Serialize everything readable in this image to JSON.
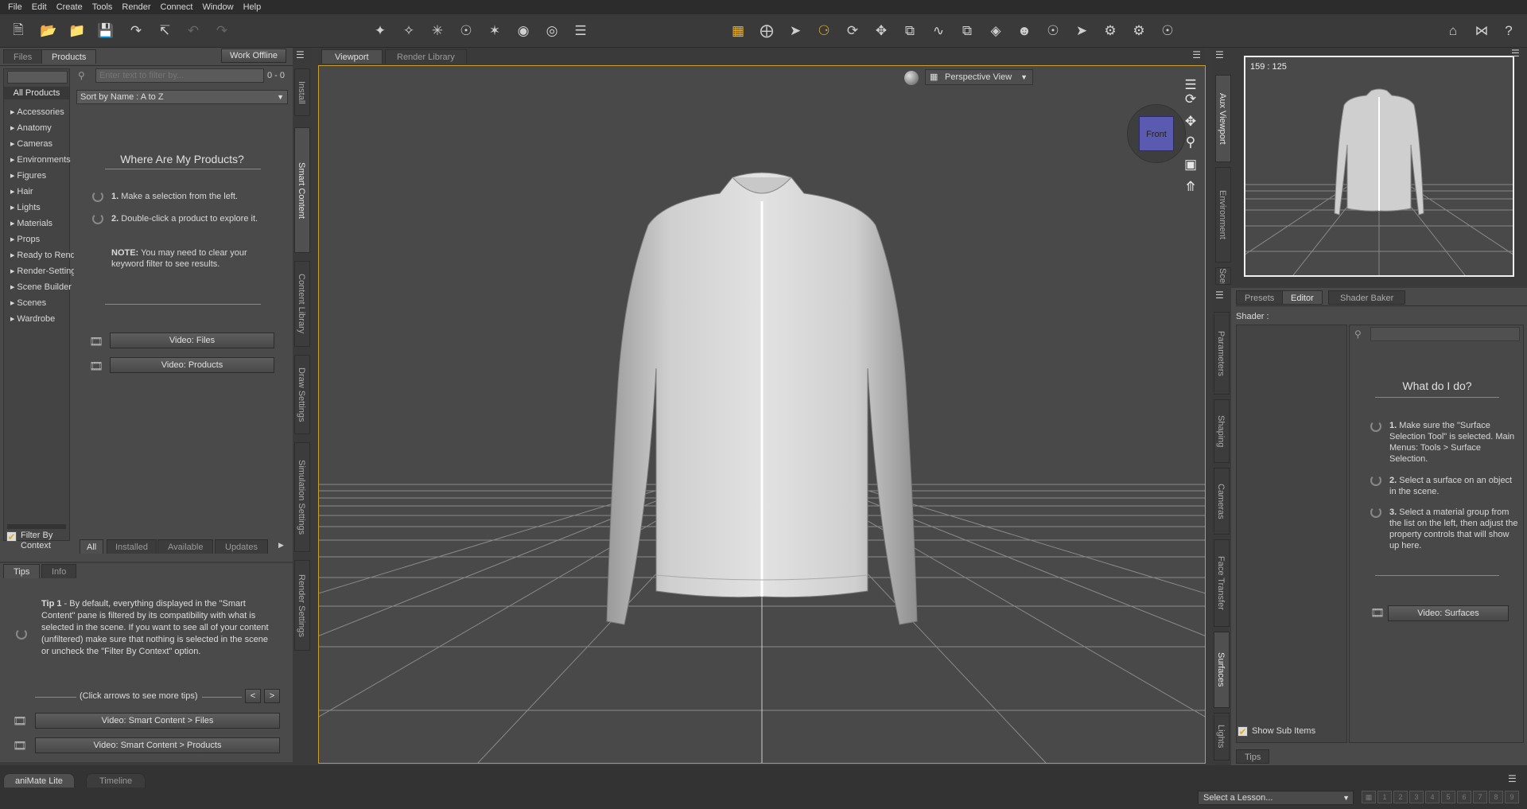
{
  "menu": [
    "File",
    "Edit",
    "Create",
    "Tools",
    "Render",
    "Connect",
    "Window",
    "Help"
  ],
  "left_panel": {
    "tabs": [
      "Files",
      "Products"
    ],
    "active_tab": "Products",
    "work_offline": "Work Offline",
    "filter_placeholder": "Enter text to filter by...",
    "count": "0 - 0",
    "sort": "Sort by Name : A to Z",
    "all_products": "All Products",
    "categories": [
      "Accessories",
      "Anatomy",
      "Cameras",
      "Environments",
      "Figures",
      "Hair",
      "Lights",
      "Materials",
      "Props",
      "Ready to Render",
      "Render-Settings",
      "Scene Builder",
      "Scenes",
      "Wardrobe"
    ],
    "help_title": "Where Are My Products?",
    "step1_num": "1.",
    "step1": "Make a selection from the left.",
    "step2_num": "2.",
    "step2": "Double-click a product to explore it.",
    "note_label": "NOTE:",
    "note": "You may need to clear your keyword filter to see results.",
    "video_files": "Video: Files",
    "video_products": "Video: Products",
    "filter_by_context": "Filter By Context",
    "bottom_tabs": [
      "All",
      "Installed",
      "Available",
      "Updates"
    ]
  },
  "side_vtabs": [
    "Install",
    "Smart Content",
    "Content Library",
    "Draw Settings",
    "Simulation Settings",
    "Render Settings"
  ],
  "tips_panel": {
    "tabs": [
      "Tips",
      "Info"
    ],
    "tip_title": "Tip 1",
    "tip_text": " - By default, everything displayed in the \"Smart Content\" pane is filtered by its compatibility with what is selected in the scene. If you want to see all of your content (unfiltered) make sure that nothing is selected in the scene or uncheck the \"Filter By Context\" option.",
    "arrows_hint": "(Click arrows to see more tips)",
    "prev": "<",
    "next": ">",
    "video1": "Video: Smart Content > Files",
    "video2": "Video: Smart Content > Products"
  },
  "viewport": {
    "tabs": [
      "Viewport",
      "Render Library"
    ],
    "view_select": "Perspective View",
    "cube_face": "Front"
  },
  "aux": {
    "vtabs": [
      "Aux Viewport",
      "Environment",
      "Scene"
    ],
    "coords": "159 : 125"
  },
  "right_panel": {
    "tabs": [
      "Presets",
      "Editor",
      "Shader Baker"
    ],
    "active_tab": "Editor",
    "shader_label": "Shader :",
    "vtabs": [
      "Parameters",
      "Shaping",
      "Cameras",
      "Face Transfer",
      "Surfaces",
      "Lights"
    ],
    "help_title": "What do I do?",
    "step1_num": "1.",
    "step1": "Make sure the \"Surface Selection Tool\" is selected. Main Menus: Tools > Surface Selection.",
    "step2_num": "2.",
    "step2": "Select a surface on an object in the scene.",
    "step3_num": "3.",
    "step3": "Select a material group from the list on the left, then adjust the property controls that will show up here.",
    "video": "Video: Surfaces",
    "show_sub_items": "Show Sub Items",
    "tips_tab": "Tips"
  },
  "bottom": {
    "tabs": [
      "aniMate Lite",
      "Timeline"
    ],
    "lesson": "Select a Lesson...",
    "lesson_pages": [
      "1",
      "2",
      "3",
      "4",
      "5",
      "6",
      "7",
      "8",
      "9"
    ]
  },
  "colors": {
    "accent": "#e0b020",
    "viewport_bg": "#4a4a4a",
    "panel_bg": "#4a4a4a"
  }
}
